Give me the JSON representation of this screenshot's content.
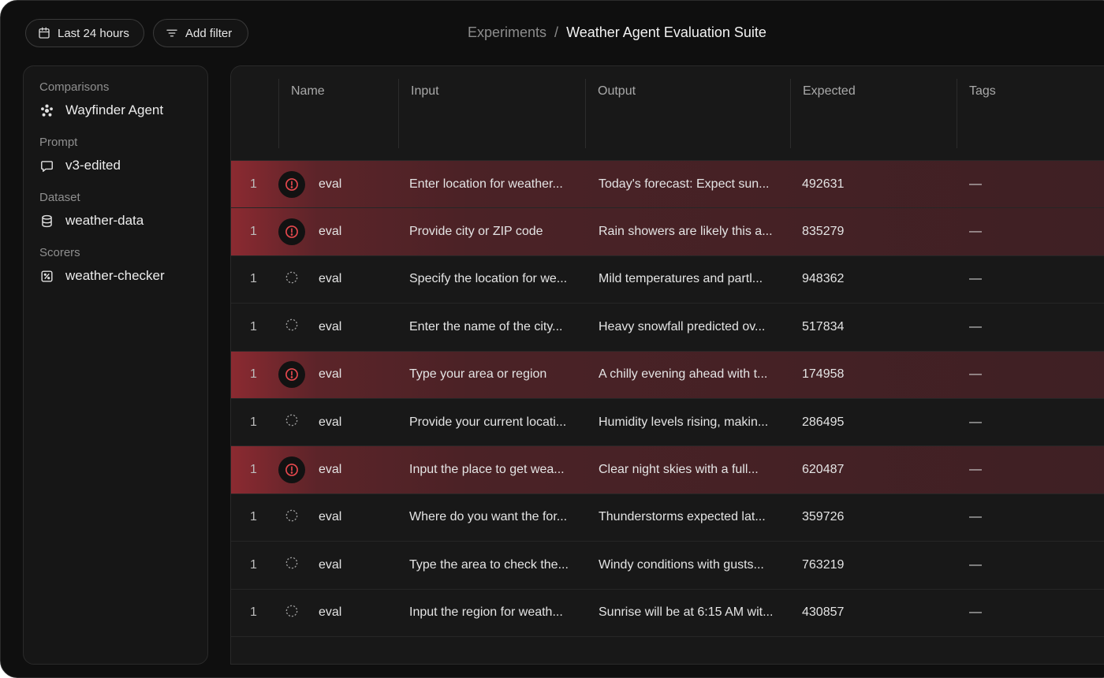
{
  "topbar": {
    "time_filter": "Last 24 hours",
    "add_filter": "Add filter",
    "breadcrumb_parent": "Experiments",
    "breadcrumb_separator": "/",
    "breadcrumb_current": "Weather Agent Evaluation Suite"
  },
  "sidebar": {
    "comparisons_label": "Comparisons",
    "comparisons_value": "Wayfinder Agent",
    "prompt_label": "Prompt",
    "prompt_value": "v3-edited",
    "dataset_label": "Dataset",
    "dataset_value": "weather-data",
    "scorers_label": "Scorers",
    "scorers_value": "weather-checker"
  },
  "table": {
    "columns": [
      "Name",
      "Input",
      "Output",
      "Expected",
      "Tags"
    ],
    "rows": [
      {
        "num": "1",
        "status": "error",
        "name": "eval",
        "input": "Enter location for weather...",
        "output": "Today's forecast: Expect sun...",
        "expected": "492631",
        "tags": "—"
      },
      {
        "num": "1",
        "status": "error",
        "name": "eval",
        "input": "Provide city or ZIP code",
        "output": "Rain showers are likely this a...",
        "expected": "835279",
        "tags": "—"
      },
      {
        "num": "1",
        "status": "pending",
        "name": "eval",
        "input": "Specify the location for we...",
        "output": "Mild temperatures and partl...",
        "expected": "948362",
        "tags": "—"
      },
      {
        "num": "1",
        "status": "pending",
        "name": "eval",
        "input": "Enter the name of the city...",
        "output": "Heavy snowfall predicted ov...",
        "expected": "517834",
        "tags": "—"
      },
      {
        "num": "1",
        "status": "error",
        "name": "eval",
        "input": "Type your area or region",
        "output": "A chilly evening ahead with t...",
        "expected": "174958",
        "tags": "—"
      },
      {
        "num": "1",
        "status": "pending",
        "name": "eval",
        "input": "Provide your current locati...",
        "output": "Humidity levels rising, makin...",
        "expected": "286495",
        "tags": "—"
      },
      {
        "num": "1",
        "status": "error",
        "name": "eval",
        "input": "Input the place to get wea...",
        "output": "Clear night skies with a full...",
        "expected": "620487",
        "tags": "—"
      },
      {
        "num": "1",
        "status": "pending",
        "name": "eval",
        "input": "Where do you want the for...",
        "output": "Thunderstorms expected lat...",
        "expected": "359726",
        "tags": "—"
      },
      {
        "num": "1",
        "status": "pending",
        "name": "eval",
        "input": "Type the area to check the...",
        "output": "Windy conditions with gusts...",
        "expected": "763219",
        "tags": "—"
      },
      {
        "num": "1",
        "status": "pending",
        "name": "eval",
        "input": "Input the region for weath...",
        "output": "Sunrise will be at 6:15 AM wit...",
        "expected": "430857",
        "tags": "—"
      }
    ]
  },
  "colors": {
    "background": "#0f0f0f",
    "panel": "#161616",
    "error_accent": "#e5484d",
    "error_row": "#4b2226"
  },
  "icons": {
    "time_filter": "calendar-icon",
    "add_filter": "filter-icon",
    "comparisons": "agent-icon",
    "prompt": "chat-bubble-icon",
    "dataset": "database-icon",
    "scorers": "percent-icon",
    "error_status": "alert-circle-icon",
    "pending_status": "dashed-circle-icon"
  }
}
